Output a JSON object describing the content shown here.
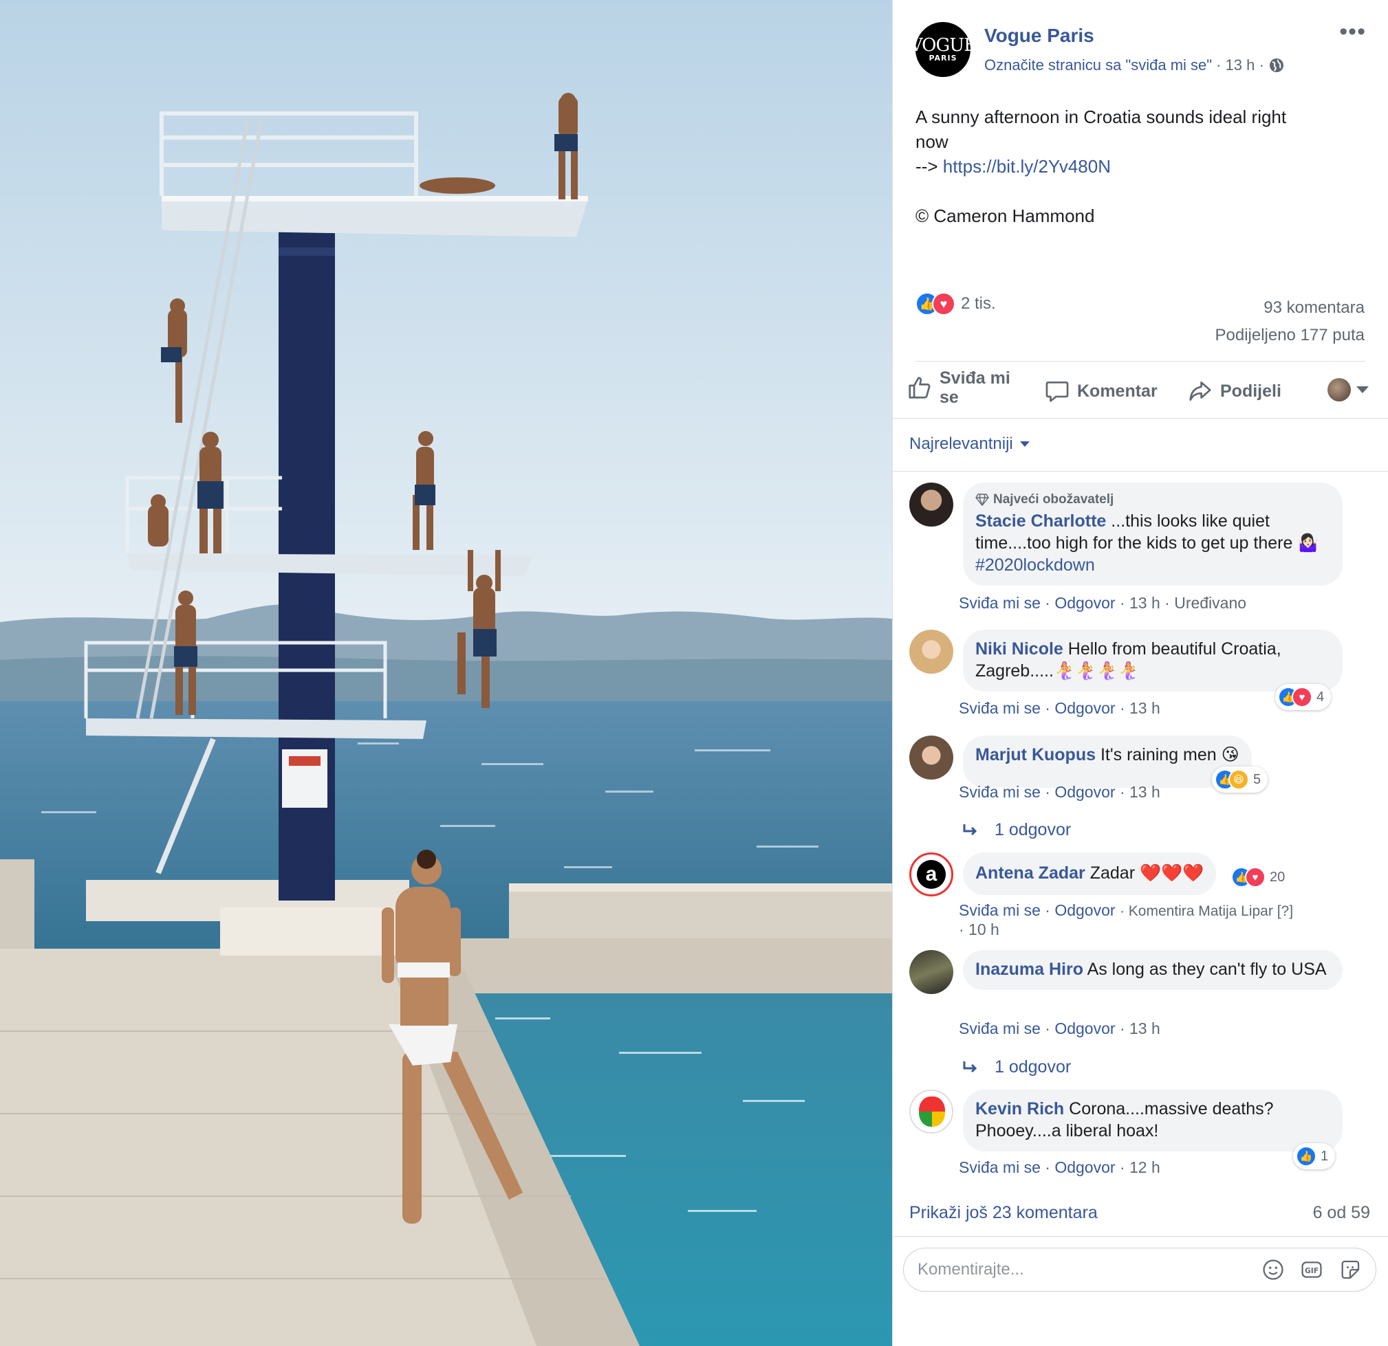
{
  "page": {
    "name": "Vogue Paris",
    "logo_line1": "VOGUE",
    "logo_line2": "PARIS",
    "like_page": "Označite stranicu sa \"sviđa mi se\"",
    "time": "· 13 h ·",
    "more": "•••"
  },
  "post": {
    "line1": "A sunny afternoon in Croatia sounds ideal right",
    "line2": "now",
    "arrow": "-->",
    "link": "https://bit.ly/2Yv480N",
    "credit": "© Cameron Hammond"
  },
  "stats": {
    "reactions": "2 tis.",
    "comments": "93 komentara",
    "shares": "Podijeljeno 177 puta"
  },
  "actions": {
    "like": "Sviđa mi se",
    "comment": "Komentar",
    "share": "Podijeli"
  },
  "sort": {
    "label": "Najrelevantniji"
  },
  "comments": [
    {
      "badge": "Najveći obožavatelj",
      "author": "Stacie Charlotte",
      "text": "...this looks like quiet time....too high for the kids to get up there 🤷🏻‍♀️",
      "hashtag": "#2020lockdown",
      "like": "Sviđa mi se",
      "reply": "Odgovor",
      "time": "· 13 h ·",
      "edited": "Uređivano"
    },
    {
      "author": "Niki Nicole",
      "text": "Hello from beautiful Croatia, Zagreb.....🧜‍♀️🧜‍♀️🧜‍♀️🧜‍♀️",
      "like": "Sviđa mi se",
      "reply": "Odgovor",
      "time": "· 13 h",
      "reaction_count": "4"
    },
    {
      "author": "Marjut Kuopus",
      "text": "It's raining men 😘",
      "like": "Sviđa mi se",
      "reply": "Odgovor",
      "time": "· 13 h",
      "reaction_count": "5",
      "replies": "1 odgovor"
    },
    {
      "author": "Antena Zadar",
      "text": "Zadar ❤️❤️❤️",
      "like": "Sviđa mi se",
      "reply": "Odgovor",
      "commented_by": "· Komentira Matija Lipar [?]",
      "time": "· 10 h",
      "reaction_count": "20"
    },
    {
      "author": "Inazuma Hiro",
      "text": "As long as they can't fly to USA",
      "like": "Sviđa mi se",
      "reply": "Odgovor",
      "time": "· 13 h",
      "replies": "1 odgovor"
    },
    {
      "author": "Kevin Rich",
      "text": "Corona....massive deaths? Phooey....a liberal hoax!",
      "like": "Sviđa mi se",
      "reply": "Odgovor",
      "time": "· 12 h",
      "reaction_count": "1"
    }
  ],
  "footer": {
    "more_comments": "Prikaži još 23 komentara",
    "count": "6 od 59",
    "input_placeholder": "Komentirajte..."
  },
  "colors": {
    "link": "#385898",
    "secondary": "#606770",
    "bubble": "#f2f3f5",
    "like_blue": "#1877f2",
    "love_red": "#f33e58"
  }
}
